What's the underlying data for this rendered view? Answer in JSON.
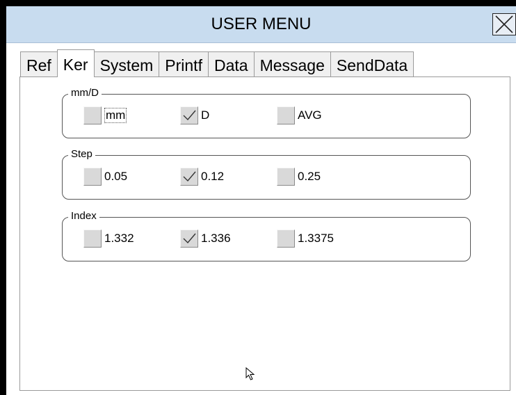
{
  "window": {
    "title": "USER MENU"
  },
  "tabs": [
    {
      "label": "Ref",
      "active": false
    },
    {
      "label": "Ker",
      "active": true
    },
    {
      "label": "System",
      "active": false
    },
    {
      "label": "Printf",
      "active": false
    },
    {
      "label": "Data",
      "active": false
    },
    {
      "label": "Message",
      "active": false
    },
    {
      "label": "SendData",
      "active": false
    }
  ],
  "groups": {
    "mmd": {
      "label": "mm/D",
      "options": [
        {
          "label": "mm",
          "checked": false
        },
        {
          "label": "D",
          "checked": true
        },
        {
          "label": "AVG",
          "checked": false
        }
      ]
    },
    "step": {
      "label": "Step",
      "options": [
        {
          "label": "0.05",
          "checked": false
        },
        {
          "label": "0.12",
          "checked": true
        },
        {
          "label": "0.25",
          "checked": false
        }
      ]
    },
    "index": {
      "label": "Index",
      "options": [
        {
          "label": "1.332",
          "checked": false
        },
        {
          "label": "1.336",
          "checked": true
        },
        {
          "label": "1.3375",
          "checked": false
        }
      ]
    }
  },
  "colors": {
    "titlebar": "#c8dcef",
    "checkbox": "#d9d9d9",
    "frame": "#000000"
  },
  "icons": {
    "close": "close-icon",
    "check": "checkmark-icon",
    "cursor": "mouse-pointer-icon"
  }
}
